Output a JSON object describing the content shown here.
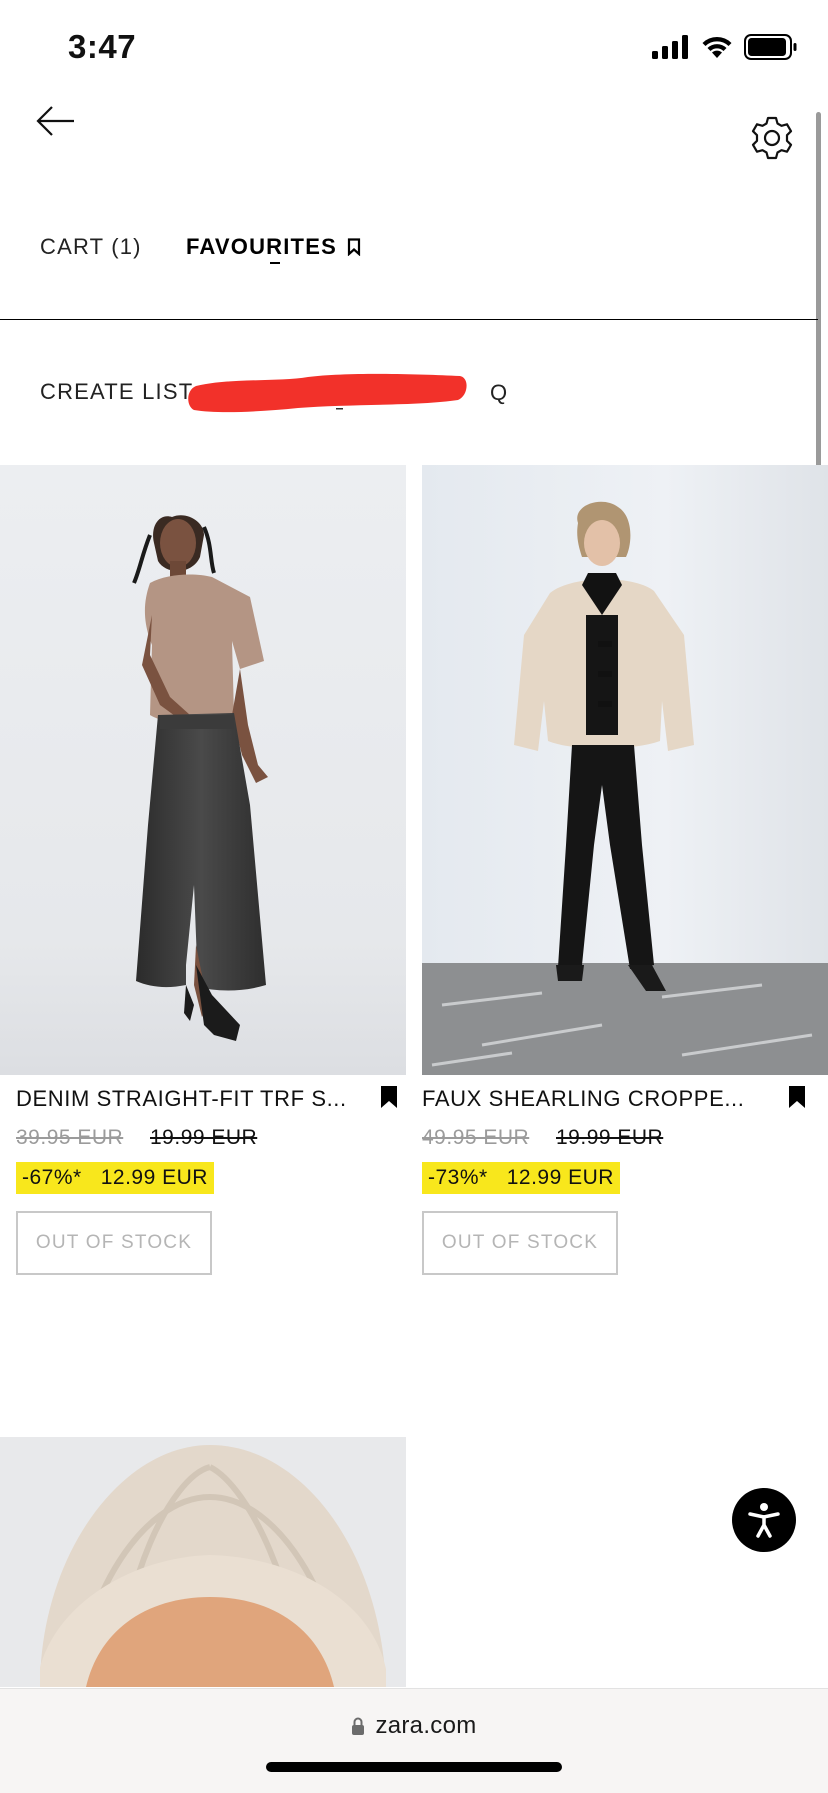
{
  "status_bar": {
    "time": "3:47"
  },
  "tabs": {
    "cart_label": "CART (1)",
    "favourites_label": "FAVOURITES"
  },
  "list_bar": {
    "create_list_label": "CREATE LIST",
    "trailing_text": "Q"
  },
  "products": [
    {
      "name": "DENIM STRAIGHT-FIT TRF S...",
      "original_price": "39.95 EUR",
      "previous_price": "19.99 EUR",
      "discount": "-67%*",
      "sale_price": "12.99 EUR",
      "stock_button": "OUT OF STOCK"
    },
    {
      "name": "FAUX SHEARLING CROPPE...",
      "original_price": "49.95 EUR",
      "previous_price": "19.99 EUR",
      "discount": "-73%*",
      "sale_price": "12.99 EUR",
      "stock_button": "OUT OF STOCK"
    }
  ],
  "browser": {
    "url": "zara.com"
  },
  "colors": {
    "sale_highlight": "#f8e71c",
    "redaction": "#f2312a",
    "accessibility_button": "#000000"
  },
  "icons": [
    "back-arrow-icon",
    "gear-icon",
    "bookmark-icon",
    "accessibility-icon",
    "lock-icon",
    "signal-icon",
    "wifi-icon",
    "battery-icon"
  ]
}
